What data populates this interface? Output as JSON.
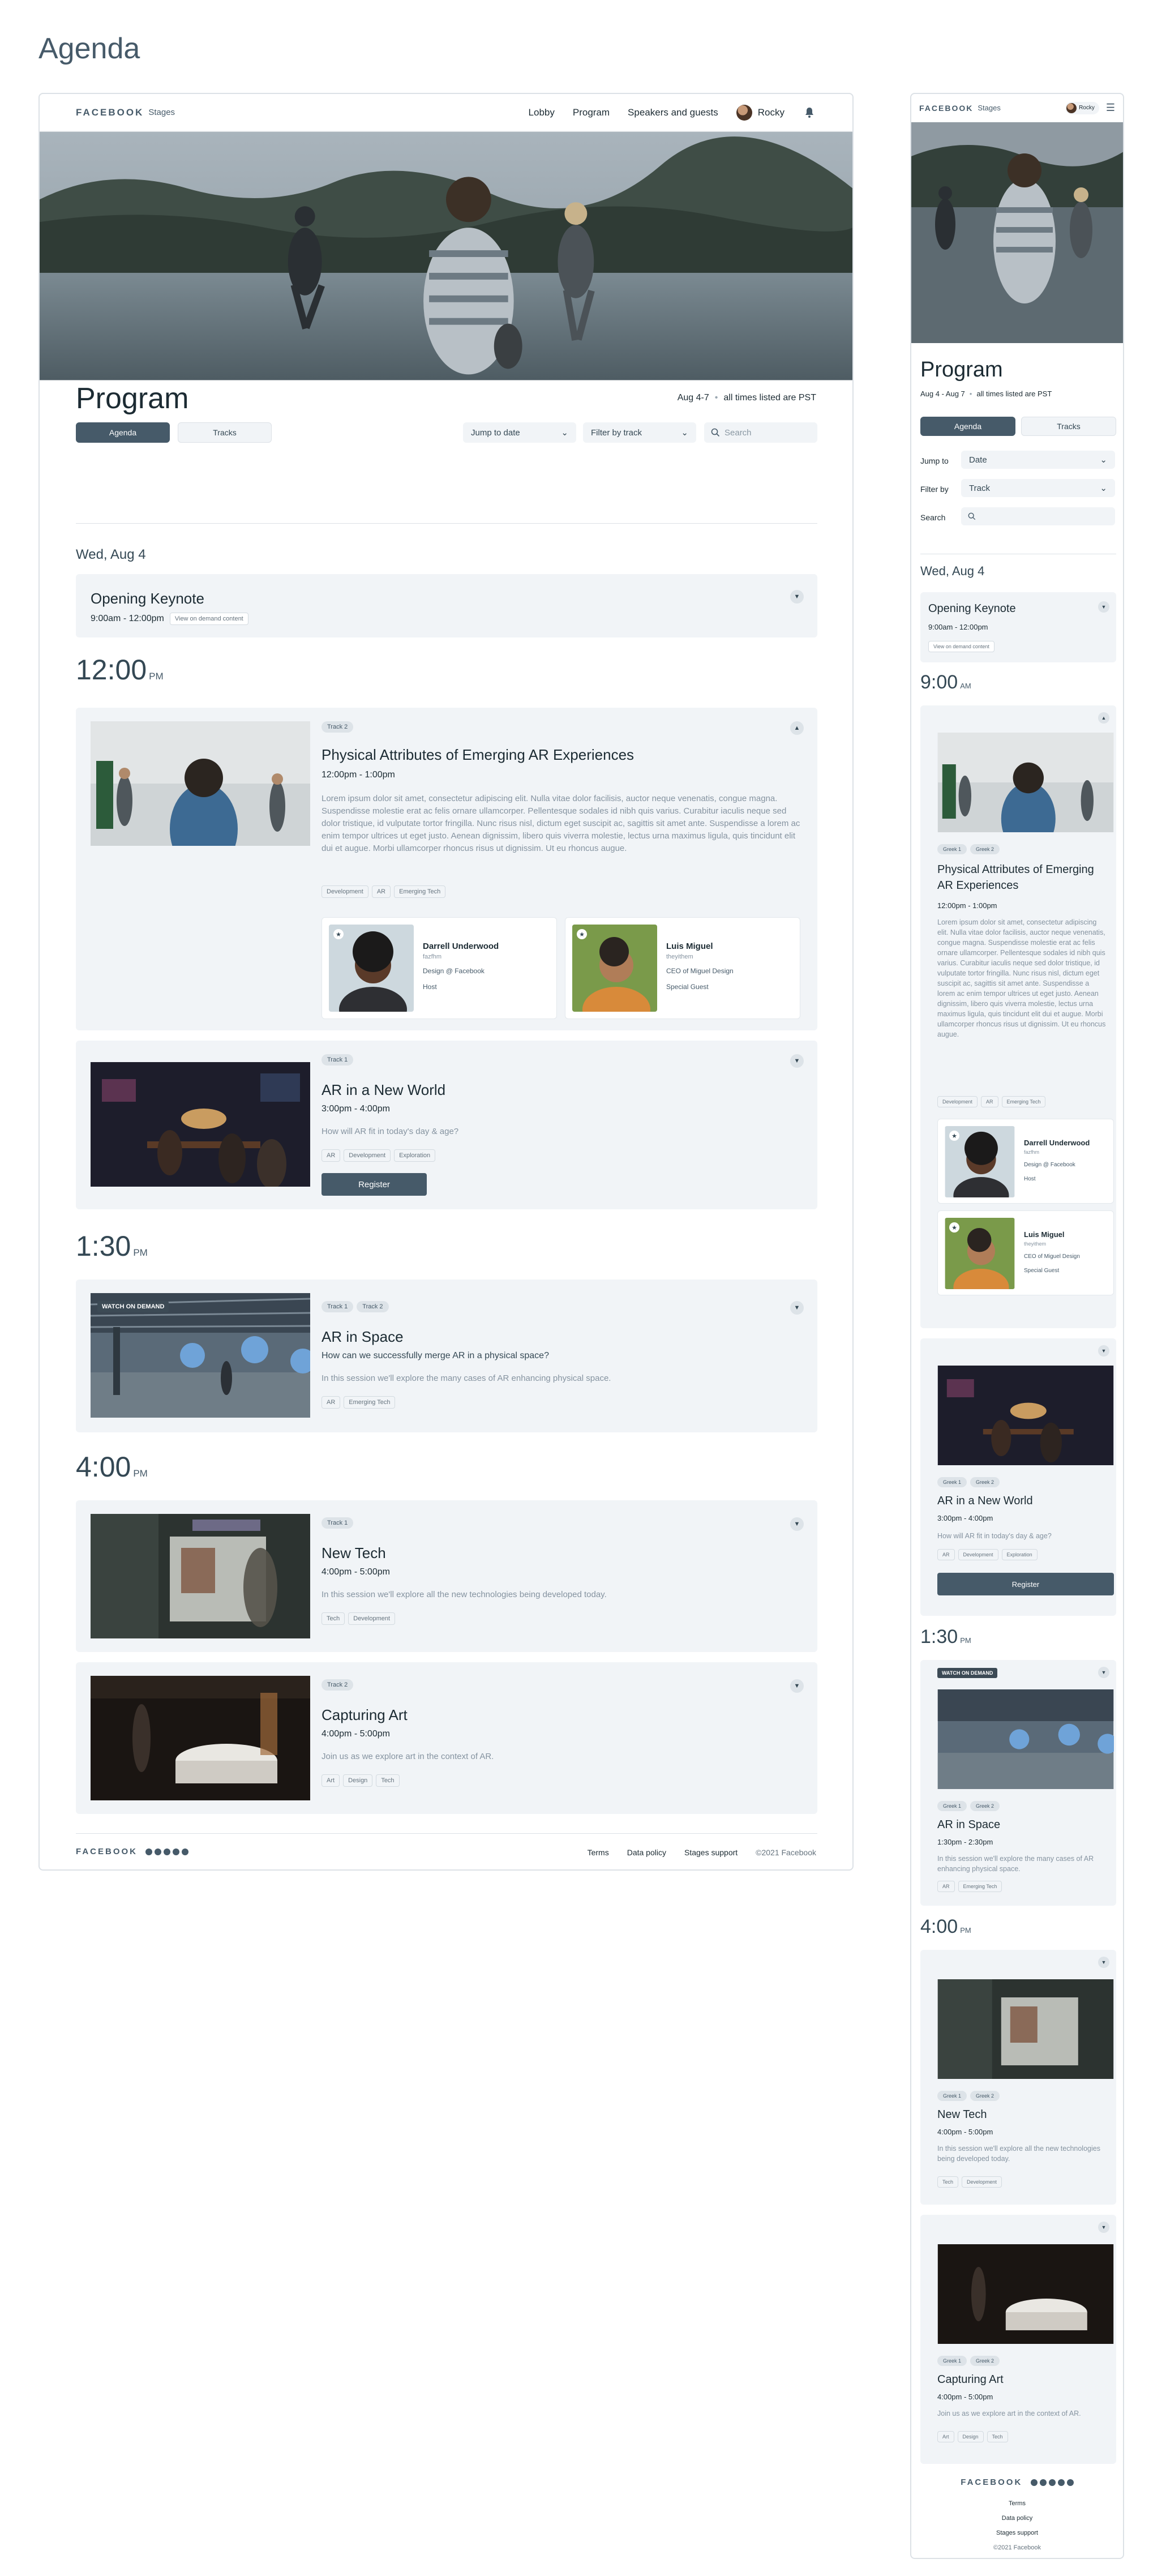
{
  "page_heading": "Agenda",
  "nav": {
    "brand": "FACEBOOK",
    "brand_sub": "Stages",
    "links": [
      "Lobby",
      "Program",
      "Speakers and guests"
    ],
    "user_name": "Rocky"
  },
  "program": {
    "title": "Program",
    "date_range": "Aug 4-7",
    "timezone_note": "all times listed are PST",
    "tabs": [
      "Agenda",
      "Tracks"
    ],
    "jump_to_date": "Jump to date",
    "filter_by_track": "Filter by track",
    "search_placeholder": "Search"
  },
  "day_label": "Wed, Aug 4",
  "keynote": {
    "title": "Opening Keynote",
    "time": "9:00am - 12:00pm",
    "chip": "View on demand content"
  },
  "time_groups": [
    {
      "time": "12:00",
      "ampm": "PM"
    },
    {
      "time": "1:30",
      "ampm": "PM"
    },
    {
      "time": "4:00",
      "ampm": "PM"
    }
  ],
  "sessions": [
    {
      "badges": [
        "Track 2"
      ],
      "title": "Physical Attributes of Emerging AR Experiences",
      "time": "12:00pm - 1:00pm",
      "description": "Lorem ipsum dolor sit amet, consectetur adipiscing elit. Nulla vitae dolor facilisis, auctor neque venenatis, congue magna. Suspendisse molestie erat ac felis ornare ullamcorper. Pellentesque sodales id nibh quis varius. Curabitur iaculis neque sed dolor tristique, id vulputate tortor fringilla. Nunc risus nisl, dictum eget suscipit ac, sagittis sit amet ante. Suspendisse a lorem ac enim tempor ultrices ut eget justo. Aenean dignissim, libero quis viverra molestie, lectus urna maximus ligula, quis tincidunt elit dui et augue. Morbi ullamcorper rhoncus risus ut dignissim. Ut eu rhoncus augue.",
      "tags": [
        "Development",
        "AR",
        "Emerging Tech"
      ],
      "speakers": [
        {
          "name": "Darrell Underwood",
          "handle": "fazfhm",
          "role": "Design @ Facebook",
          "tag": "Host"
        },
        {
          "name": "Luis Miguel",
          "handle": "theyithem",
          "role": "CEO of Miguel Design",
          "tag": "Special Guest"
        }
      ]
    },
    {
      "badges": [
        "Track 1"
      ],
      "title": "AR in a New World",
      "time": "3:00pm - 4:00pm",
      "description": "How will AR fit in today's day & age?",
      "tags": [
        "AR",
        "Development",
        "Exploration"
      ],
      "register": "Register"
    },
    {
      "badges": [
        "Track 1",
        "Track 2"
      ],
      "title": "AR in Space",
      "subtitle": "How can we successfully merge AR in a physical space?",
      "description": "In this session we'll explore the many cases of AR enhancing physical space.",
      "tags": [
        "AR",
        "Emerging Tech"
      ],
      "overlay": "WATCH ON DEMAND"
    },
    {
      "badges": [
        "Track 1"
      ],
      "title": "New Tech",
      "time": "4:00pm - 5:00pm",
      "description": "In this session we'll explore all the new technologies being developed today.",
      "tags": [
        "Tech",
        "Development"
      ]
    },
    {
      "badges": [
        "Track 2"
      ],
      "title": "Capturing Art",
      "time": "4:00pm - 5:00pm",
      "description": "Join us as we explore art in the context of AR.",
      "tags": [
        "Art",
        "Design",
        "Tech"
      ]
    }
  ],
  "footer": {
    "brand": "FACEBOOK",
    "links": [
      "Terms",
      "Data policy",
      "Stages support",
      "©2021 Facebook"
    ]
  },
  "mobile": {
    "date_range": "Aug 4 - Aug 7",
    "jump_to_label": "Jump to",
    "jump_to_value": "Date",
    "filter_label": "Filter by",
    "filter_value": "Track",
    "search_label": "Search",
    "first_time": {
      "time": "9:00",
      "ampm": "AM"
    },
    "badges": [
      "Greek 1",
      "Greek 2"
    ],
    "ar_space_time": "1:30pm - 2:30pm"
  },
  "colors": {
    "accent": "#465a69",
    "card": "#f1f4f7",
    "text": "#1c2b33"
  }
}
